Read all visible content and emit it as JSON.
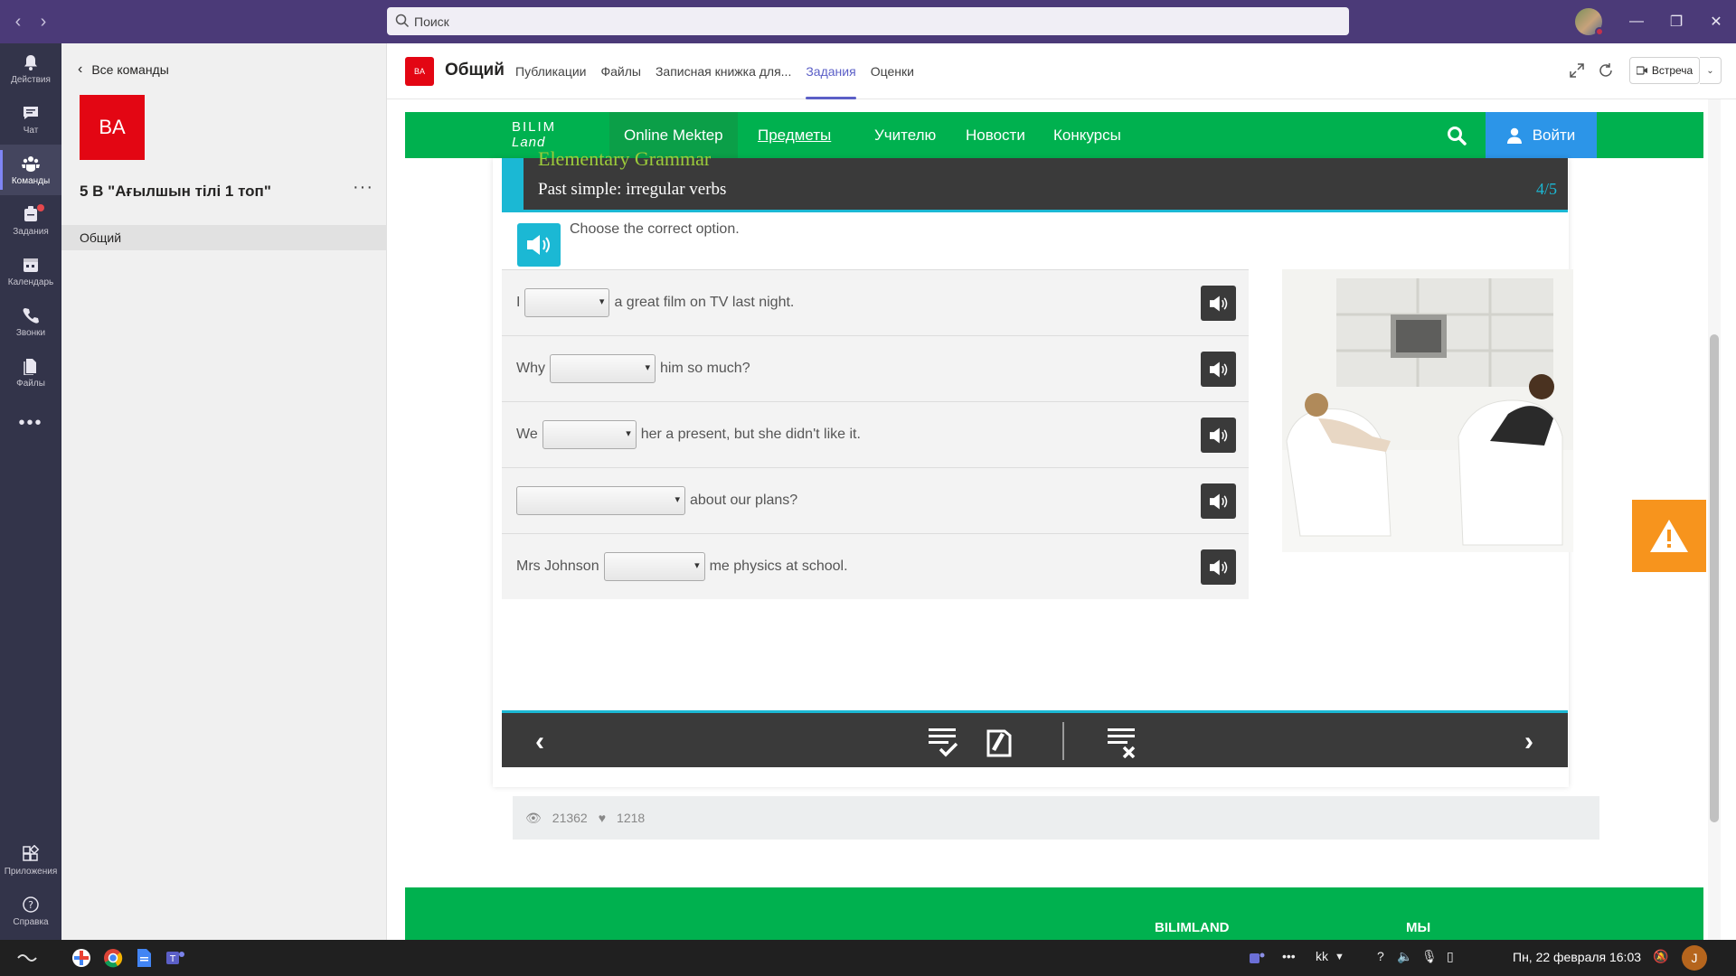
{
  "titlebar": {
    "search_placeholder": "Поиск"
  },
  "rail": {
    "items": [
      {
        "label": "Действия"
      },
      {
        "label": "Чат"
      },
      {
        "label": "Команды"
      },
      {
        "label": "Задания"
      },
      {
        "label": "Календарь"
      },
      {
        "label": "Звонки"
      },
      {
        "label": "Файлы"
      },
      {
        "label": "Приложения"
      },
      {
        "label": "Справка"
      }
    ]
  },
  "team": {
    "back_label": "Все команды",
    "logo_text": "BA",
    "name": "5 В \"Ағылшын тілі 1 топ\"",
    "channel": "Общий"
  },
  "channel_bar": {
    "logo_text": "BA",
    "title": "Общий",
    "tabs": [
      "Публикации",
      "Файлы",
      "Записная книжка для...",
      "Задания",
      "Оценки"
    ],
    "active_tab": "Задания",
    "meet_label": "Встреча"
  },
  "site_nav": {
    "logo_line1": "BILIM",
    "logo_line2": "Land",
    "items": [
      "Online Mektep",
      "Предметы",
      "Учителю",
      "Новости",
      "Конкурсы"
    ],
    "login_label": "Войти"
  },
  "lesson": {
    "supertitle": "Elementary Grammar",
    "title": "Past simple: irregular verbs",
    "page": "4/5",
    "instruction": "Choose the correct option.",
    "questions": [
      {
        "before": "I",
        "after": "a great film on TV last night."
      },
      {
        "before": "Why",
        "after": "him so much?"
      },
      {
        "before": "We",
        "after": "her a present, but she didn't like it."
      },
      {
        "before": "",
        "after": "about our plans?"
      },
      {
        "before": "Mrs Johnson",
        "after": "me physics at school."
      }
    ]
  },
  "stats": {
    "views": "21362",
    "likes": "1218"
  },
  "footer": {
    "col1": "BILIMLAND",
    "col2": "МЫ"
  },
  "taskbar": {
    "lang": "kk",
    "clock": "Пн, 22 февраля  16:03",
    "user_initial": "J"
  },
  "colors": {
    "teams_purple": "#4b3a78",
    "rail": "#33344a",
    "bilimland_green": "#00b14f",
    "accent_cyan": "#1bb8d4",
    "login_blue": "#2c95e8",
    "warning_orange": "#f7941d"
  }
}
